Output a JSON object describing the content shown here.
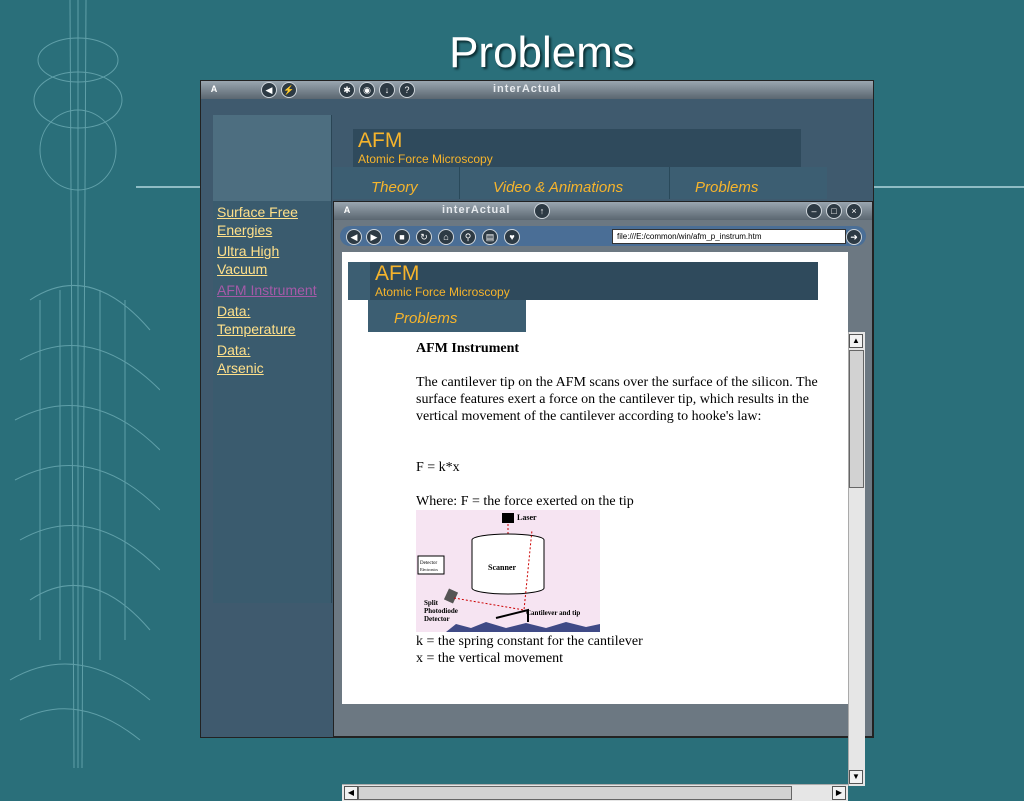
{
  "slide": {
    "title": "Problems"
  },
  "outer_window": {
    "brand": "interActual",
    "toolbar_icons": [
      "logo-a-icon",
      "back-icon",
      "flash-icon",
      "tools-icon",
      "eye-icon",
      "download-icon",
      "help-icon"
    ]
  },
  "site": {
    "banner_title": "AFM",
    "banner_subtitle": "Atomic Force Microscopy",
    "tabs": [
      "Theory",
      "Video & Animations",
      "Problems"
    ]
  },
  "sidebar": {
    "links": [
      {
        "label": "Surface Free Energies",
        "visited": false
      },
      {
        "label": "Ultra High Vacuum",
        "visited": false
      },
      {
        "label": "AFM Instrument",
        "visited": true
      },
      {
        "label": "Data: Temperature",
        "visited": false
      },
      {
        "label": "Data: Arsenic",
        "visited": false
      }
    ]
  },
  "inner_window": {
    "brand": "interActual",
    "url": "file:///E:/common/win/afm_p_instrum.htm"
  },
  "inner_page": {
    "banner_title": "AFM",
    "banner_subtitle": "Atomic Force Microscopy",
    "tab": "Problems",
    "heading": "AFM Instrument",
    "paragraph": "The cantilever tip on the AFM scans over the surface of the silicon. The surface features exert a force on the cantilever tip, which results in the vertical movement of the cantilever according to hooke's law:",
    "formula": "F = k*x",
    "where": "Where: F = the force exerted on the tip",
    "k_def": "k = the spring constant for the cantilever",
    "x_def": "x = the vertical movement"
  },
  "diagram": {
    "laser": "Laser",
    "scanner": "Scanner",
    "detector_1": "Detector",
    "detector_2": "Electronics",
    "split_1": "Split",
    "split_2": "Photodiode",
    "split_3": "Detector",
    "cantilever": "Cantilever and tip"
  },
  "colors": {
    "accent": "#f6b42c",
    "link": "#ffe08a",
    "visited": "#a55aa8",
    "background": "#2a6f7a"
  }
}
